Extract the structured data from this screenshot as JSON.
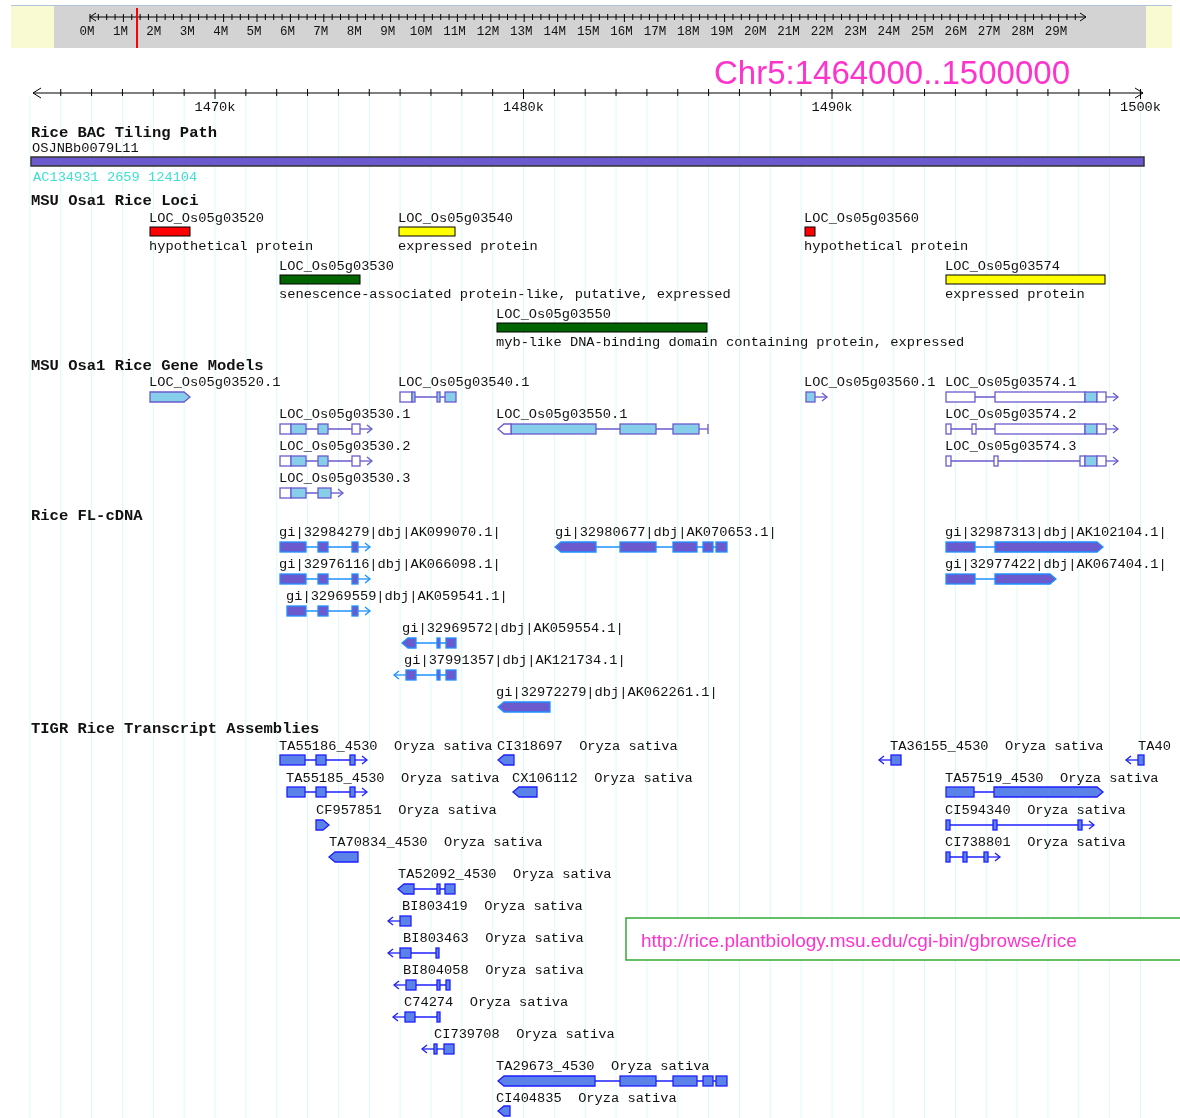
{
  "overview": {
    "labels": [
      "0M",
      "1M",
      "2M",
      "3M",
      "4M",
      "5M",
      "6M",
      "7M",
      "8M",
      "9M",
      "10M",
      "11M",
      "12M",
      "13M",
      "14M",
      "15M",
      "16M",
      "17M",
      "18M",
      "19M",
      "20M",
      "21M",
      "22M",
      "23M",
      "24M",
      "25M",
      "26M",
      "27M",
      "28M",
      "29M"
    ]
  },
  "location": "Chr5:1464000..1500000",
  "ruler": {
    "labels": [
      "1470k",
      "1480k",
      "1490k",
      "1500k"
    ]
  },
  "tracks": [
    {
      "title": "Rice BAC Tiling Path",
      "kind": "bac",
      "features": [
        {
          "name": "OSJNBb0079L11",
          "note": "AC134931 2659 124104"
        }
      ]
    },
    {
      "title": "MSU Osa1 Rice Loci",
      "kind": "loci",
      "features": [
        {
          "name": "LOC_Os05g03520",
          "description": "hypothetical protein",
          "color": "#ff0000"
        },
        {
          "name": "LOC_Os05g03540",
          "description": "expressed protein",
          "color": "#ffff00"
        },
        {
          "name": "LOC_Os05g03560",
          "description": "hypothetical protein",
          "color": "#ff0000"
        },
        {
          "name": "LOC_Os05g03530",
          "description": "senescence-associated protein-like, putative, expressed",
          "color": "#006400"
        },
        {
          "name": "LOC_Os05g03574",
          "description": "expressed protein",
          "color": "#ffff00"
        },
        {
          "name": "LOC_Os05g03550",
          "description": "myb-like DNA-binding domain containing protein, expressed",
          "color": "#006400"
        }
      ]
    },
    {
      "title": "MSU Osa1 Rice Gene Models",
      "kind": "models",
      "features": [
        {
          "name": "LOC_Os05g03520.1"
        },
        {
          "name": "LOC_Os05g03540.1"
        },
        {
          "name": "LOC_Os05g03560.1"
        },
        {
          "name": "LOC_Os05g03574.1"
        },
        {
          "name": "LOC_Os05g03530.1"
        },
        {
          "name": "LOC_Os05g03550.1"
        },
        {
          "name": "LOC_Os05g03574.2"
        },
        {
          "name": "LOC_Os05g03530.2"
        },
        {
          "name": "LOC_Os05g03574.3"
        },
        {
          "name": "LOC_Os05g03530.3"
        }
      ]
    },
    {
      "title": "Rice FL-cDNA",
      "kind": "cdna",
      "features": [
        {
          "name": "gi|32984279|dbj|AK099070.1|"
        },
        {
          "name": "gi|32980677|dbj|AK070653.1|"
        },
        {
          "name": "gi|32987313|dbj|AK102104.1|"
        },
        {
          "name": "gi|32976116|dbj|AK066098.1|"
        },
        {
          "name": "gi|32977422|dbj|AK067404.1|"
        },
        {
          "name": "gi|32969559|dbj|AK059541.1|"
        },
        {
          "name": "gi|32969572|dbj|AK059554.1|"
        },
        {
          "name": "gi|37991357|dbj|AK121734.1|"
        },
        {
          "name": "gi|32972279|dbj|AK062261.1|"
        }
      ]
    },
    {
      "title": "TIGR Rice Transcript Assemblies",
      "kind": "assemblies",
      "features": [
        {
          "name": "TA55186_4530",
          "species": "Oryza sativa"
        },
        {
          "name": "CI318697",
          "species": "Oryza sativa"
        },
        {
          "name": "TA36155_4530",
          "species": "Oryza sativa"
        },
        {
          "name": "TA40"
        },
        {
          "name": "TA55185_4530",
          "species": "Oryza sativa"
        },
        {
          "name": "CX106112",
          "species": "Oryza sativa"
        },
        {
          "name": "TA57519_4530",
          "species": "Oryza sativa"
        },
        {
          "name": "CF957851",
          "species": "Oryza sativa"
        },
        {
          "name": "CI594340",
          "species": "Oryza sativa"
        },
        {
          "name": "TA70834_4530",
          "species": "Oryza sativa"
        },
        {
          "name": "CI738801",
          "species": "Oryza sativa"
        },
        {
          "name": "TA52092_4530",
          "species": "Oryza sativa"
        },
        {
          "name": "BI803419",
          "species": "Oryza sativa"
        },
        {
          "name": "BI803463",
          "species": "Oryza sativa"
        },
        {
          "name": "BI804058",
          "species": "Oryza sativa"
        },
        {
          "name": "C74274",
          "species": "Oryza sativa"
        },
        {
          "name": "CI739708",
          "species": "Oryza sativa"
        },
        {
          "name": "TA29673_4530",
          "species": "Oryza sativa"
        },
        {
          "name": "CI404835",
          "species": "Oryza sativa"
        }
      ]
    }
  ],
  "url_note": "http://rice.plantbiology.msu.edu/cgi-bin/gbrowse/rice"
}
